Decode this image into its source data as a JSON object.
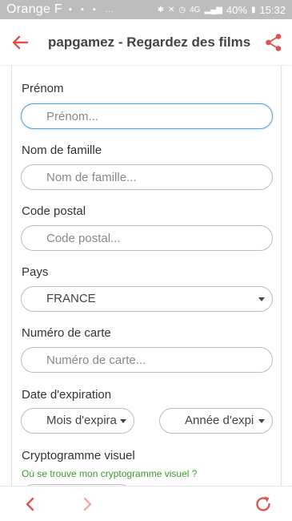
{
  "status_bar": {
    "carrier": "Orange F",
    "battery": "40%",
    "time": "15:32",
    "network": "4G"
  },
  "app_bar": {
    "title": "papgamez - Regardez des films"
  },
  "form": {
    "first_name": {
      "label": "Prénom",
      "placeholder": "Prénom..."
    },
    "last_name": {
      "label": "Nom de famille",
      "placeholder": "Nom de famille..."
    },
    "postal_code": {
      "label": "Code postal",
      "placeholder": "Code postal..."
    },
    "country": {
      "label": "Pays",
      "value": "FRANCE"
    },
    "card_number": {
      "label": "Numéro de carte",
      "placeholder": "Numéro de carte..."
    },
    "expiration": {
      "label": "Date d'expiration",
      "month": "Mois d'expira",
      "year": "Année d'expi"
    },
    "cvv": {
      "label": "Cryptogramme visuel",
      "help": "Où se trouve mon cryptogramme visuel ?"
    }
  },
  "colors": {
    "accent": "#e05252",
    "focus": "#5aa2d9",
    "link": "#3a9a2a",
    "status_bar": "#bdbdbd"
  }
}
